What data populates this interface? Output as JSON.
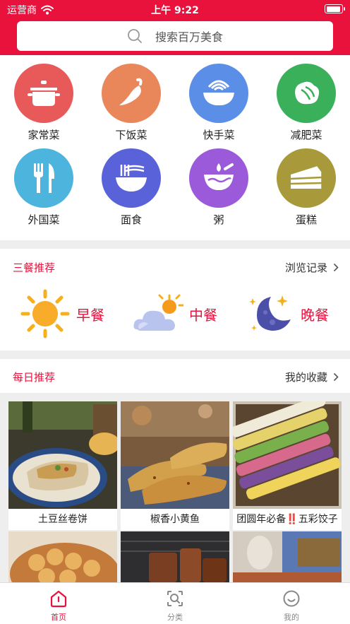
{
  "status_bar": {
    "carrier": "运营商",
    "time": "上午 9:22"
  },
  "search": {
    "placeholder": "搜索百万美食"
  },
  "categories": [
    {
      "label": "家常菜",
      "icon": "pot-icon",
      "color": "#e85a5a"
    },
    {
      "label": "下饭菜",
      "icon": "chili-icon",
      "color": "#e9875b"
    },
    {
      "label": "快手菜",
      "icon": "noodle-bowl-icon",
      "color": "#5b8ee6"
    },
    {
      "label": "减肥菜",
      "icon": "vegetable-icon",
      "color": "#3bb05b"
    },
    {
      "label": "外国菜",
      "icon": "fork-knife-icon",
      "color": "#4cb4dd"
    },
    {
      "label": "面食",
      "icon": "noodles-icon",
      "color": "#5a62d9"
    },
    {
      "label": "粥",
      "icon": "porridge-bowl-icon",
      "color": "#9b5ad9"
    },
    {
      "label": "蛋糕",
      "icon": "cake-icon",
      "color": "#a89a3a"
    }
  ],
  "meals_section": {
    "title": "三餐推荐",
    "link": "浏览记录",
    "meals": [
      {
        "label": "早餐",
        "icon": "sun-icon"
      },
      {
        "label": "中餐",
        "icon": "sun-cloud-icon"
      },
      {
        "label": "晚餐",
        "icon": "moon-stars-icon"
      }
    ]
  },
  "daily_section": {
    "title": "每日推荐",
    "link": "我的收藏",
    "recipes": [
      {
        "title": "土豆丝卷饼"
      },
      {
        "title": "椒香小黄鱼"
      },
      {
        "title": "团圆年必备‼️五彩饺子"
      },
      {
        "title": ""
      },
      {
        "title": ""
      },
      {
        "title": ""
      }
    ]
  },
  "tabbar": {
    "tabs": [
      {
        "label": "首页",
        "icon": "home-icon",
        "active": true
      },
      {
        "label": "分类",
        "icon": "category-search-icon",
        "active": false
      },
      {
        "label": "我的",
        "icon": "profile-smile-icon",
        "active": false
      }
    ]
  },
  "colors": {
    "brand": "#e8123c",
    "background": "#eeeeee"
  }
}
